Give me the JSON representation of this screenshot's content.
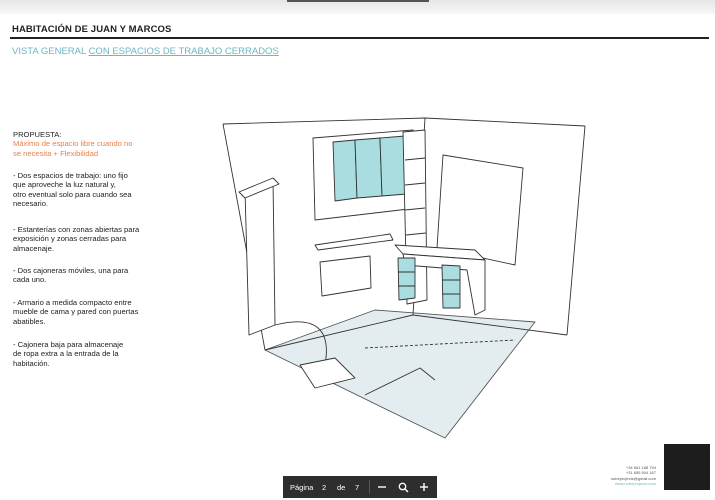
{
  "header": {
    "title": "HABITACIÓN DE JUAN Y MARCOS",
    "subtitle_plain": "VISTA GENERAL ",
    "subtitle_underlined": "CON ESPACIOS DE TRABAJO CERRADOS"
  },
  "proposal": {
    "heading": "PROPUESTA:",
    "highlight_line1": "Máximo de espacio libre cuando no",
    "highlight_line2": "se necesita + Flexibilidad",
    "items": [
      [
        "- Dos espacios de trabajo: uno fijo",
        "que aproveche la luz natural y,",
        "otro eventual solo para cuando sea",
        "necesario."
      ],
      [
        "- Estanterías con zonas abiertas para",
        "exposición y zonas cerradas para",
        "almacenaje."
      ],
      [
        "- Dos cajoneras móviles, una para",
        "cada uno."
      ],
      [
        "- Armario a medida compacto entre",
        "mueble de cama y pared con puertas",
        "abatibles."
      ],
      [
        "- Cajonera baja para almacenaje",
        "de ropa extra a la entrada de la",
        "habitación."
      ]
    ]
  },
  "contact": {
    "phone1": "+34 661 188 794",
    "phone2": "+31 655 504 167",
    "email": "nubeprojects@gmail.com",
    "web": "www.nubeprojects.com"
  },
  "pager": {
    "page_label": "Página",
    "current_page": "2",
    "of_label": "de",
    "total_pages": "7"
  },
  "colors": {
    "accent_blue": "#6fb5c0",
    "accent_orange": "#e8804a",
    "furniture_fill": "#a9dde0",
    "floor_fill": "#e3edf0"
  }
}
